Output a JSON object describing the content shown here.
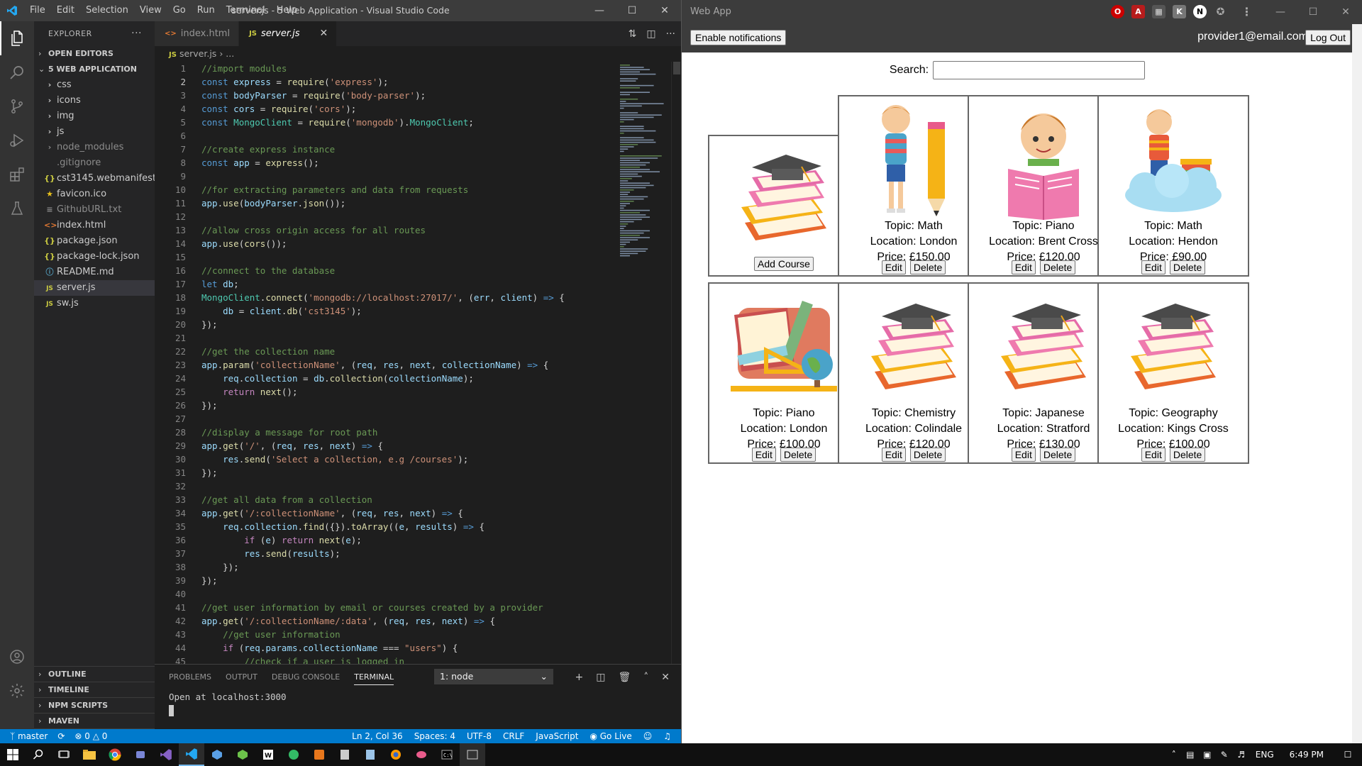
{
  "vscode": {
    "menu": [
      "File",
      "Edit",
      "Selection",
      "View",
      "Go",
      "Run",
      "Terminal",
      "Help"
    ],
    "title": "server.js - 5 Web Application - Visual Studio Code",
    "explorer_label": "EXPLORER",
    "open_editors": "OPEN EDITORS",
    "project": "5 WEB APPLICATION",
    "folders": [
      "css",
      "icons",
      "img",
      "js",
      "node_modules"
    ],
    "files": [
      ".gitignore",
      "cst3145.webmanifest",
      "favicon.ico",
      "GithubURL.txt",
      "index.html",
      "package.json",
      "package-lock.json",
      "README.md",
      "server.js",
      "sw.js"
    ],
    "outline_sections": [
      "OUTLINE",
      "TIMELINE",
      "NPM SCRIPTS",
      "MAVEN"
    ],
    "tabs": [
      "index.html",
      "server.js"
    ],
    "breadcrumb": [
      "server.js",
      "..."
    ],
    "panel_tabs": [
      "PROBLEMS",
      "OUTPUT",
      "DEBUG CONSOLE",
      "TERMINAL"
    ],
    "terminal_select": "1: node",
    "terminal_output": "Open at localhost:3000",
    "status": {
      "branch": "master",
      "errors": "0",
      "warnings": "0",
      "position": "Ln 2, Col 36",
      "spaces": "Spaces: 4",
      "encoding": "UTF-8",
      "eol": "CRLF",
      "language": "JavaScript",
      "golive": "Go Live"
    },
    "code": [
      "//import modules",
      "const express = require('express');",
      "const bodyParser = require('body-parser');",
      "const cors = require('cors');",
      "const MongoClient = require('mongodb').MongoClient;",
      "",
      "//create express instance",
      "const app = express();",
      "",
      "//for extracting parameters and data from requests",
      "app.use(bodyParser.json());",
      "",
      "//allow cross origin access for all routes",
      "app.use(cors());",
      "",
      "//connect to the database",
      "let db;",
      "MongoClient.connect('mongodb://localhost:27017/', (err, client) => {",
      "    db = client.db('cst3145');",
      "});",
      "",
      "//get the collection name",
      "app.param('collectionName', (req, res, next, collectionName) => {",
      "    req.collection = db.collection(collectionName);",
      "    return next();",
      "});",
      "",
      "//display a message for root path",
      "app.get('/', (req, res, next) => {",
      "    res.send('Select a collection, e.g /courses');",
      "});",
      "",
      "//get all data from a collection",
      "app.get('/:collectionName', (req, res, next) => {",
      "    req.collection.find({}).toArray((e, results) => {",
      "        if (e) return next(e);",
      "        res.send(results);",
      "    });",
      "});",
      "",
      "//get user information by email or courses created by a provider",
      "app.get('/:collectionName/:data', (req, res, next) => {",
      "    //get user information",
      "    if (req.params.collectionName === \"users\") {",
      "        //check if a user is logged in"
    ]
  },
  "webapp": {
    "window_title": "Web App",
    "notif_button": "Enable notifications",
    "user_email": "provider1@email.com",
    "logout_button": "Log Out",
    "search_label": "Search:",
    "search_value": "",
    "add_course_button": "Add Course",
    "edit_label": "Edit",
    "delete_label": "Delete",
    "courses": [
      {
        "topic": "Topic: Math",
        "location": "Location: London",
        "price": "Price: £150.00",
        "icon": "boy-with-pencil-icon"
      },
      {
        "topic": "Topic: Piano",
        "location": "Location: Brent Cross",
        "price": "Price: £120.00",
        "icon": "boy-reading-book-icon"
      },
      {
        "topic": "Topic: Math",
        "location": "Location: Hendon",
        "price": "Price: £90.00",
        "icon": "boy-on-cloud-icon"
      },
      {
        "topic": "Topic: Piano",
        "location": "Location: London",
        "price": "Price: £100.00",
        "icon": "school-supplies-icon"
      },
      {
        "topic": "Topic: Chemistry",
        "location": "Location: Colindale",
        "price": "Price: £120.00",
        "icon": "books-graduation-cap-icon"
      },
      {
        "topic": "Topic: Japanese",
        "location": "Location: Stratford",
        "price": "Price: £130.00",
        "icon": "books-graduation-cap-icon"
      },
      {
        "topic": "Topic: Geography",
        "location": "Location: Kings Cross",
        "price": "Price: £100.00",
        "icon": "books-graduation-cap-icon"
      }
    ]
  },
  "taskbar": {
    "language": "ENG",
    "time": "6:49 PM"
  },
  "colors": {
    "vscode_accent": "#007acc",
    "editor_bg": "#1e1e1e",
    "webapp_header": "#3c3c3c"
  }
}
